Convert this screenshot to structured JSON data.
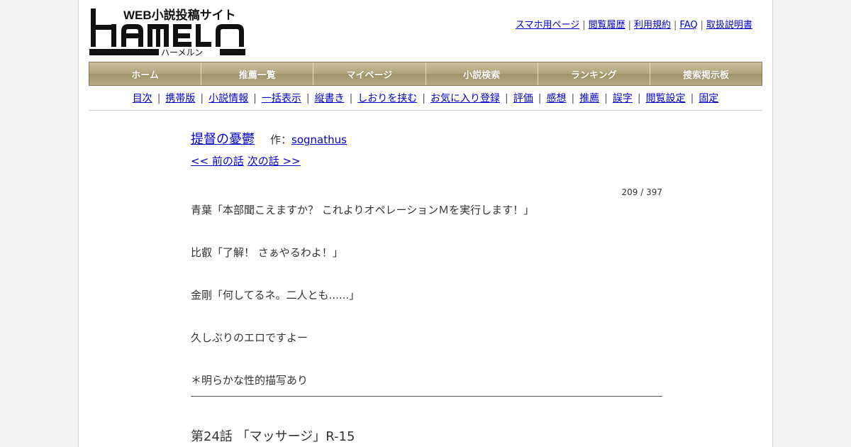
{
  "logo": {
    "main_text": "HAMELN",
    "tagline": "WEB小説投稿サイト",
    "kana": "ハーメルン"
  },
  "top_links": [
    {
      "label": "スマホ用ページ"
    },
    {
      "label": "閲覧履歴"
    },
    {
      "label": "利用規約"
    },
    {
      "label": "FAQ"
    },
    {
      "label": "取扱説明書"
    }
  ],
  "nav": [
    {
      "label": "ホーム"
    },
    {
      "label": "推薦一覧"
    },
    {
      "label": "マイページ"
    },
    {
      "label": "小説検索"
    },
    {
      "label": "ランキング"
    },
    {
      "label": "捜索掲示板"
    }
  ],
  "subnav": [
    {
      "label": "目次"
    },
    {
      "label": "携帯版"
    },
    {
      "label": "小説情報"
    },
    {
      "label": "一括表示"
    },
    {
      "label": "縦書き"
    },
    {
      "label": "しおりを挟む"
    },
    {
      "label": "お気に入り登録"
    },
    {
      "label": "評価"
    },
    {
      "label": "感想"
    },
    {
      "label": "推薦"
    },
    {
      "label": "誤字"
    },
    {
      "label": "閲覧設定"
    },
    {
      "label": "固定"
    }
  ],
  "novel": {
    "title": "提督の憂鬱",
    "author_label": "作：",
    "author": "sognathus",
    "prev_label": "<< 前の話",
    "next_label": "次の話 >>",
    "episode_count": "209 / 397",
    "preface": [
      "青葉「本部聞こえますか？ これよりオペレーションＭを実行します！」",
      "比叡「了解！ さぁやるわよ！」",
      "金剛「何してるネ。二人とも......」",
      "久しぶりのエロですよー",
      "＊明らかな性的描写あり"
    ],
    "chapter_title": "第24話 「マッサージ」R-15"
  },
  "colors": {
    "link": "#0000cc",
    "nav_bg": "#b1a37a",
    "nav_text": "#ffffff"
  }
}
